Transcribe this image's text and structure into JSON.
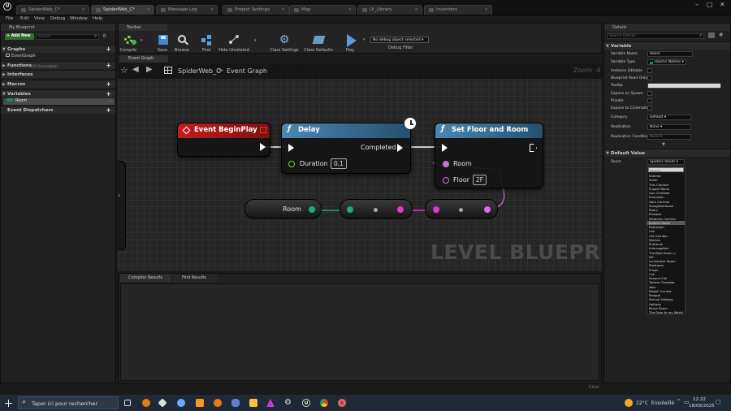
{
  "tabs": [
    {
      "label": "SpiderWeb_C*"
    },
    {
      "label": "SpiderWeb_C*"
    },
    {
      "label": "Message Log"
    },
    {
      "label": "Project Settings"
    },
    {
      "label": "Map"
    },
    {
      "label": "UI_Library"
    },
    {
      "label": "Inventory"
    }
  ],
  "menu": [
    "File",
    "Edit",
    "View",
    "Debug",
    "Window",
    "Help"
  ],
  "left": {
    "header": "My Blueprint",
    "add_new": "+ Add New",
    "search_placeholder": "Search",
    "graphs": "Graphs",
    "event_graph": "EventGraph",
    "functions": "Functions",
    "functions_sub": "(30 Overridable)",
    "interfaces": "Interfaces",
    "macros": "Macros",
    "variables": "Variables",
    "var_room": "Room",
    "dispatchers": "Event Dispatchers"
  },
  "toolbar": {
    "header": "Toolbar",
    "compile": "Compile",
    "save": "Save",
    "browse": "Browse",
    "find": "Find",
    "hide_unrelated": "Hide Unrelated",
    "class_settings": "Class Settings",
    "class_defaults": "Class Defaults",
    "play": "Play",
    "debug_select": "No debug object selected ▾",
    "debug_filter": "Debug Filter"
  },
  "graph": {
    "tab": "Event Graph",
    "breadcrumb_root": "SpiderWeb_C",
    "breadcrumb_sep": ">",
    "breadcrumb_leaf": "Event Graph",
    "zoom": "Zoom -4",
    "watermark": "LEVEL BLUEPRINT",
    "node_begin": "Event BeginPlay",
    "node_delay": "Delay",
    "delay_completed": "Completed",
    "delay_duration": "Duration",
    "delay_duration_val": "0,1",
    "node_setfloor": "Set Floor and Room",
    "set_room": "Room",
    "set_floor": "Floor",
    "set_floor_val": "2F",
    "var_room": "Room"
  },
  "bottom": {
    "tab1": "Compiler Results",
    "tab2": "Find Results",
    "clear": "Clear"
  },
  "details": {
    "header": "Details",
    "search_placeholder": "Search Details",
    "sec_variable": "Variable",
    "rows": [
      {
        "label": "Variable Name",
        "value": "Room"
      },
      {
        "label": "Variable Type",
        "value": "Rooms Names ▾"
      },
      {
        "label": "Instance Editable"
      },
      {
        "label": "Blueprint Read Only"
      },
      {
        "label": "Tooltip",
        "value": ""
      },
      {
        "label": "Expose on Spawn"
      },
      {
        "label": "Private"
      },
      {
        "label": "Expose to Cinematics"
      },
      {
        "label": "Category",
        "value": "Default ▾"
      },
      {
        "label": "Replication",
        "value": "None ▾"
      },
      {
        "label": "Replication Condition",
        "value": "None ▾"
      }
    ],
    "sec_default": "Default Value",
    "default_label": "Room",
    "default_value": "Spiders Room ▾",
    "dropdown_search": "Search",
    "options": [
      "Exterior",
      "Salon",
      "This Corridor",
      "Puppet Room",
      "Gaz Chamber",
      "Execution",
      "Dark Corridor",
      "Slaughterhouse",
      "Stairs",
      "Elevator",
      "Madness Corridor",
      "Spiders Room",
      "Bathroom",
      "Lab",
      "Old Corridor",
      "Kitchen",
      "Entrance",
      "Interrogation",
      "The Best Room :)",
      "WC",
      "Incinerator Room",
      "Restroom",
      "Prison",
      "Cell",
      "Second Cell",
      "Torture Chamber",
      "Attic",
      "Bright Corridor",
      "Morgue",
      "Eternal Hallway",
      "Hallway",
      "Music Room",
      "The Gate to my World"
    ],
    "selected": "Spiders Room"
  },
  "taskbar": {
    "search": "Taper ici pour rechercher",
    "weather": "22°C  Ensoleillé",
    "time": "12:22",
    "date": "18/09/2025"
  }
}
